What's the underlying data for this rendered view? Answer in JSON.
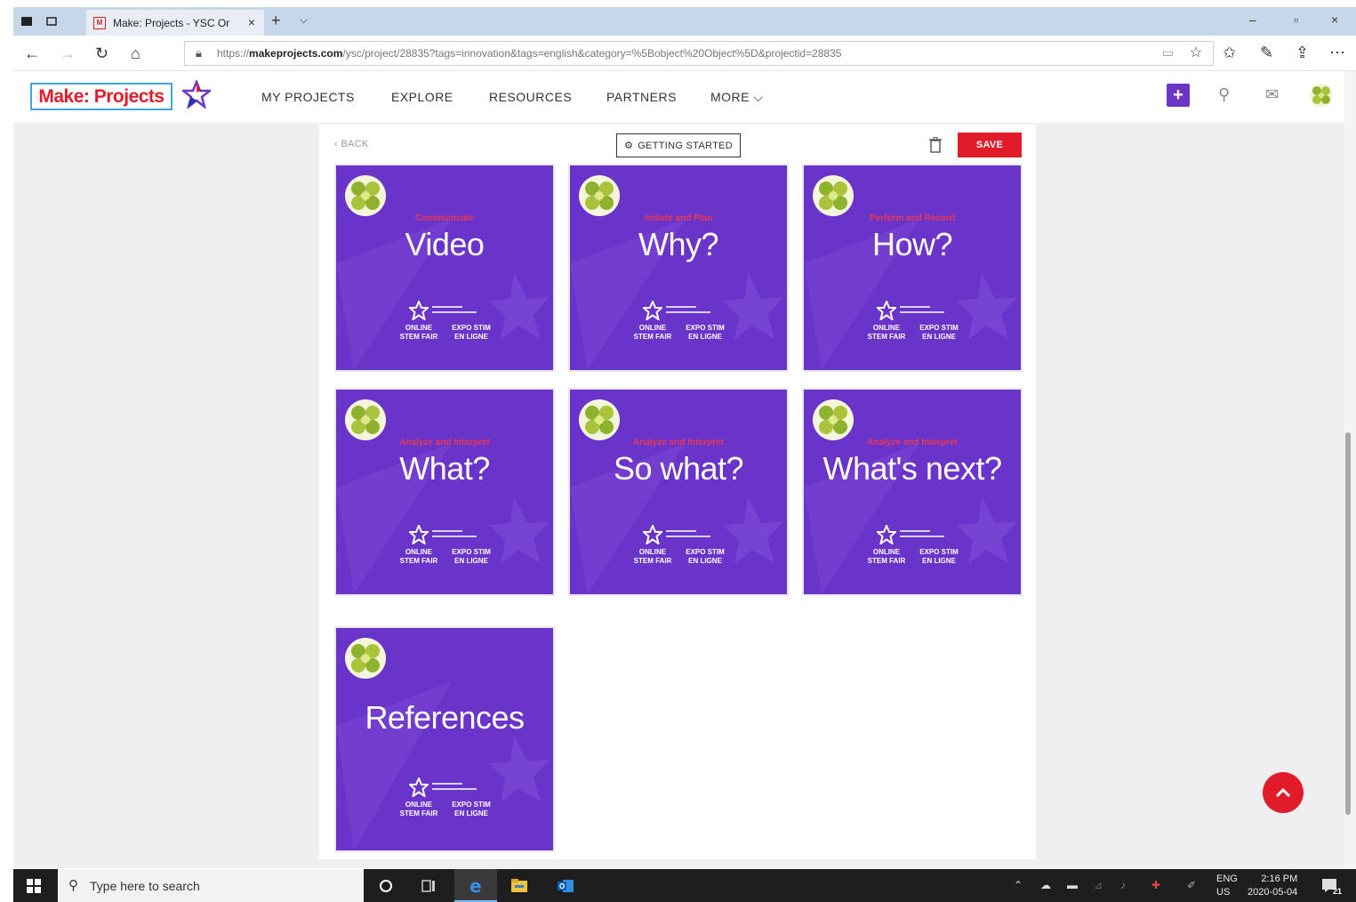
{
  "browser": {
    "tab_title": "Make: Projects - YSC Or",
    "tab_favicon": "M",
    "url_prefix": "https://",
    "url_domain": "makeprojects.com",
    "url_rest": "/ysc/project/28835?tags=innovation&tags=english&category=%5Bobject%20Object%5D&projectid=28835"
  },
  "site": {
    "logo": "Make: Projects",
    "nav": [
      "MY PROJECTS",
      "EXPLORE",
      "RESOURCES",
      "PARTNERS",
      "MORE"
    ],
    "add_label": "+"
  },
  "editor": {
    "back": "BACK",
    "getting_started": "GETTING STARTED",
    "save": "SAVE"
  },
  "cards": [
    {
      "title": "Video",
      "subtitle": "Communicate"
    },
    {
      "title": "Why?",
      "subtitle": "Initiate and Plan"
    },
    {
      "title": "How?",
      "subtitle": "Perform and Record"
    },
    {
      "title": "What?",
      "subtitle": "Analyze and Interpret"
    },
    {
      "title": "So what?",
      "subtitle": "Analyze and Interpret"
    },
    {
      "title": "What's next?",
      "subtitle": "Analyze and Interpret"
    },
    {
      "title": "References",
      "subtitle": ""
    }
  ],
  "card_brand": {
    "left": "ONLINE\nSTEM FAIR",
    "right": "EXPO STIM\nEN LIGNE"
  },
  "taskbar": {
    "search_placeholder": "Type here to search",
    "lang1": "ENG",
    "lang2": "US",
    "time": "2:16 PM",
    "date": "2020-05-04",
    "notif_count": "21"
  },
  "colors": {
    "card_purple": "#6a33c9",
    "brand_red": "#e21b2a",
    "accent_purple": "#6c36c4"
  }
}
